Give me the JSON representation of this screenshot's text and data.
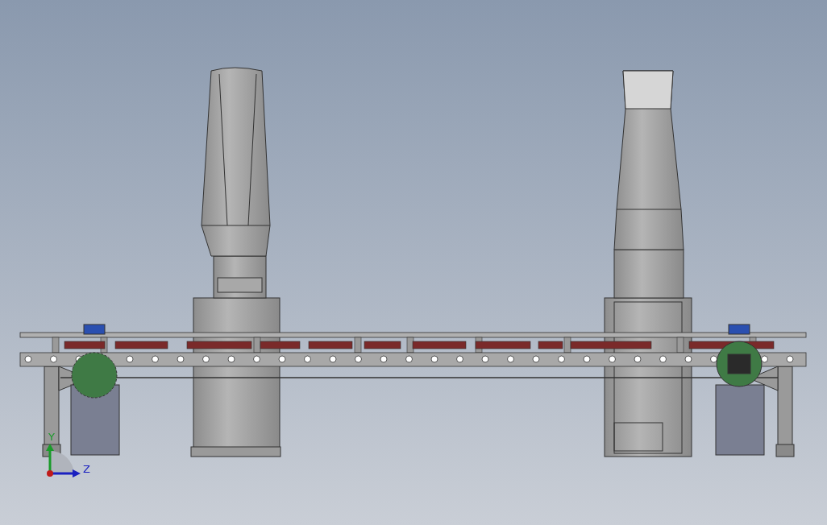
{
  "viewport": {
    "axis_labels": [
      {
        "kind": "y",
        "label": "Y"
      },
      {
        "kind": "z",
        "label": "Z"
      }
    ]
  }
}
